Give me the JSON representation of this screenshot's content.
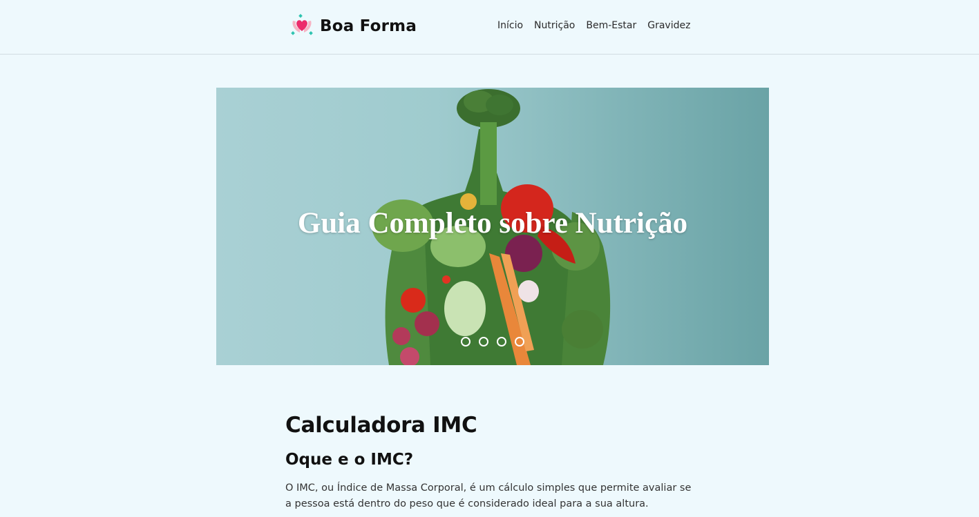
{
  "brand": {
    "name": "Boa Forma",
    "icon": "heart-hands-icon"
  },
  "nav": {
    "items": [
      {
        "label": "Início"
      },
      {
        "label": "Nutrição"
      },
      {
        "label": "Bem-Estar"
      },
      {
        "label": "Gravidez"
      }
    ]
  },
  "carousel": {
    "title": "Guia Completo sobre Nutrição",
    "slide_count": 4,
    "image": "vegetables-body-illustration"
  },
  "main": {
    "title": "Calculadora IMC",
    "subtitle": "Oque e o IMC?",
    "paragraph": "O IMC, ou Índice de Massa Corporal, é um cálculo simples que permite avaliar se a pessoa está dentro do peso que é considerado ideal para a sua altura."
  },
  "colors": {
    "background": "#eef9fd",
    "accent": "#ec2c6b",
    "carousel_bg": "#9fcbce"
  }
}
